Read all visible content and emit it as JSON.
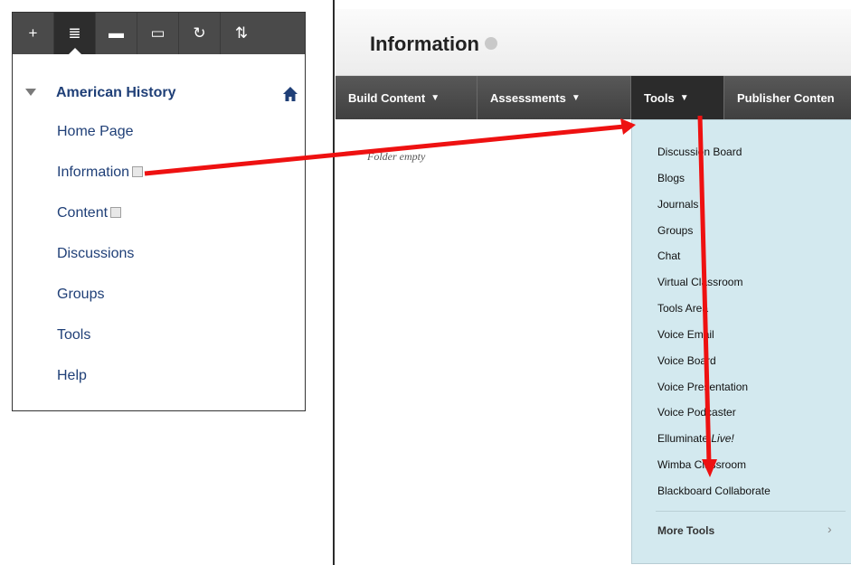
{
  "left_panel": {
    "toolbar": [
      {
        "name": "add-icon",
        "glyph": "+"
      },
      {
        "name": "list-view-icon",
        "glyph": "≣"
      },
      {
        "name": "folder-view-icon",
        "glyph": "▬"
      },
      {
        "name": "window-icon",
        "glyph": "▭"
      },
      {
        "name": "refresh-icon",
        "glyph": "↻"
      },
      {
        "name": "sort-icon",
        "glyph": "⇅"
      }
    ],
    "course_title": "American History",
    "items": [
      {
        "label": "Home Page",
        "flag": false
      },
      {
        "label": "Information",
        "flag": true
      },
      {
        "label": "Content",
        "flag": true
      },
      {
        "label": "Discussions",
        "flag": false
      },
      {
        "label": "Groups",
        "flag": false
      },
      {
        "label": "Tools",
        "flag": false
      },
      {
        "label": "Help",
        "flag": false
      }
    ]
  },
  "content": {
    "page_title": "Information",
    "action_bar": [
      "Build Content",
      "Assessments",
      "Tools",
      "Publisher Conten"
    ],
    "active_tab": "Tools",
    "folder_empty": "Folder empty"
  },
  "tools_menu": {
    "items": [
      "Discussion Board",
      "Blogs",
      "Journals",
      "Groups",
      "Chat",
      "Virtual Classroom",
      "Tools Area",
      "Voice Email",
      "Voice Board",
      "Voice Presentation",
      "Voice Podcaster",
      "Elluminate Live!",
      "Wimba Classroom",
      "Blackboard Collaborate"
    ],
    "more_tools": "More Tools"
  },
  "colors": {
    "link": "#1f3f77",
    "toolbar": "#4a4a4a",
    "dropdown": "#d3e9ef",
    "annotation_arrow": "#ee1111"
  }
}
